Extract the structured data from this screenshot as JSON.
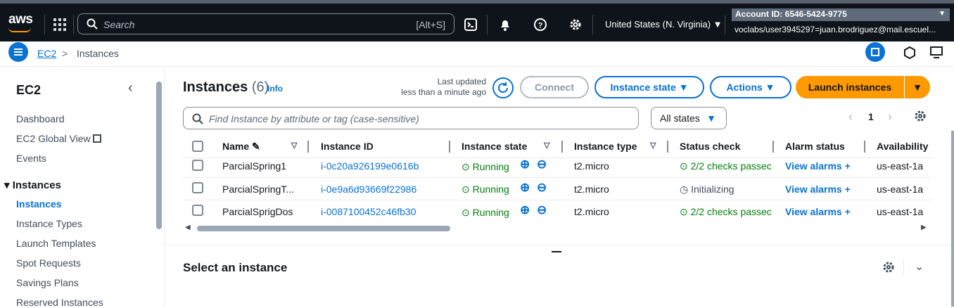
{
  "topbar": {
    "logo": "aws",
    "search_placeholder": "Search",
    "search_shortcut": "[Alt+S]",
    "region": "United States (N. Virginia)",
    "account": "Account ID: 6546-5424-9775",
    "user": "voclabs/user3945297=juan.brodriguez@mail.escuel..."
  },
  "breadcrumb": {
    "root": "EC2",
    "current": "Instances"
  },
  "sidebar": {
    "title": "EC2",
    "items": [
      "Dashboard",
      "EC2 Global View",
      "Events"
    ],
    "section": "Instances",
    "section_items": [
      "Instances",
      "Instance Types",
      "Launch Templates",
      "Spot Requests",
      "Savings Plans",
      "Reserved Instances"
    ]
  },
  "main": {
    "title": "Instances",
    "count": "(6)",
    "info": "Info",
    "last_updated_label": "Last updated",
    "last_updated_value": "less than a minute ago",
    "connect": "Connect",
    "instance_state": "Instance state",
    "actions": "Actions",
    "launch": "Launch instances",
    "filter_placeholder": "Find Instance by attribute or tag (case-sensitive)",
    "states_filter": "All states",
    "page": "1"
  },
  "table": {
    "headers": [
      "Name",
      "Instance ID",
      "Instance state",
      "Instance type",
      "Status check",
      "Alarm status",
      "Availability"
    ],
    "rows": [
      {
        "name": "ParcialSpring1",
        "id": "i-0c20a926199e0616b",
        "state": "Running",
        "type": "t2.micro",
        "status": "2/2 checks passec",
        "alarm": "View alarms",
        "az": "us-east-1a"
      },
      {
        "name": "ParcialSpringT...",
        "id": "i-0e9a6d93669f22986",
        "state": "Running",
        "type": "t2.micro",
        "status": "Initializing",
        "alarm": "View alarms",
        "az": "us-east-1a"
      },
      {
        "name": "ParcialSprigDos",
        "id": "i-0087100452c46fb30",
        "state": "Running",
        "type": "t2.micro",
        "status": "2/2 checks passec",
        "alarm": "View alarms",
        "az": "us-east-1a"
      }
    ]
  },
  "detail": {
    "title": "Select an instance"
  },
  "colors": {
    "accent": "#0972d3",
    "launch": "#ff9900",
    "success": "#037f0c"
  }
}
